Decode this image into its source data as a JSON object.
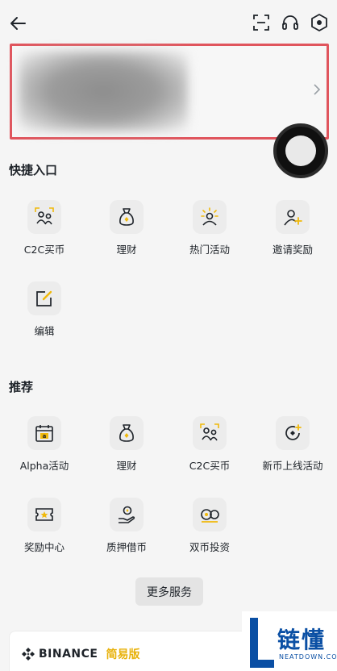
{
  "header": {
    "back_icon": "arrow-left-icon",
    "scan_icon": "scan-icon",
    "support_icon": "headset-icon",
    "settings_icon": "hexagon-settings-icon"
  },
  "profile": {
    "chevron_icon": "chevron-right-icon"
  },
  "quick_access": {
    "title": "快捷入口",
    "items": [
      {
        "label": "C2C买币",
        "icon": "c2c-users-icon"
      },
      {
        "label": "理财",
        "icon": "money-bag-icon"
      },
      {
        "label": "热门活动",
        "icon": "hot-activity-icon"
      },
      {
        "label": "邀请奖励",
        "icon": "invite-user-icon"
      },
      {
        "label": "编辑",
        "icon": "edit-icon"
      }
    ]
  },
  "recommend": {
    "title": "推荐",
    "items": [
      {
        "label": "Alpha活动",
        "icon": "alpha-calendar-icon"
      },
      {
        "label": "理财",
        "icon": "money-bag-icon"
      },
      {
        "label": "C2C买币",
        "icon": "c2c-users-icon"
      },
      {
        "label": "新币上线活动",
        "icon": "new-coin-icon"
      },
      {
        "label": "奖励中心",
        "icon": "reward-ticket-icon"
      },
      {
        "label": "质押借币",
        "icon": "pledge-loan-icon"
      },
      {
        "label": "双币投资",
        "icon": "dual-coin-icon"
      }
    ]
  },
  "more_services": "更多服务",
  "binance": {
    "brand": "BINANCE",
    "lite": "简易版"
  },
  "watermark": {
    "zh": "链懂",
    "en": "NEATDOWN.COM"
  },
  "colors": {
    "accent": "#f0b90b",
    "highlight_border": "#e0555d",
    "text": "#1e2329"
  }
}
